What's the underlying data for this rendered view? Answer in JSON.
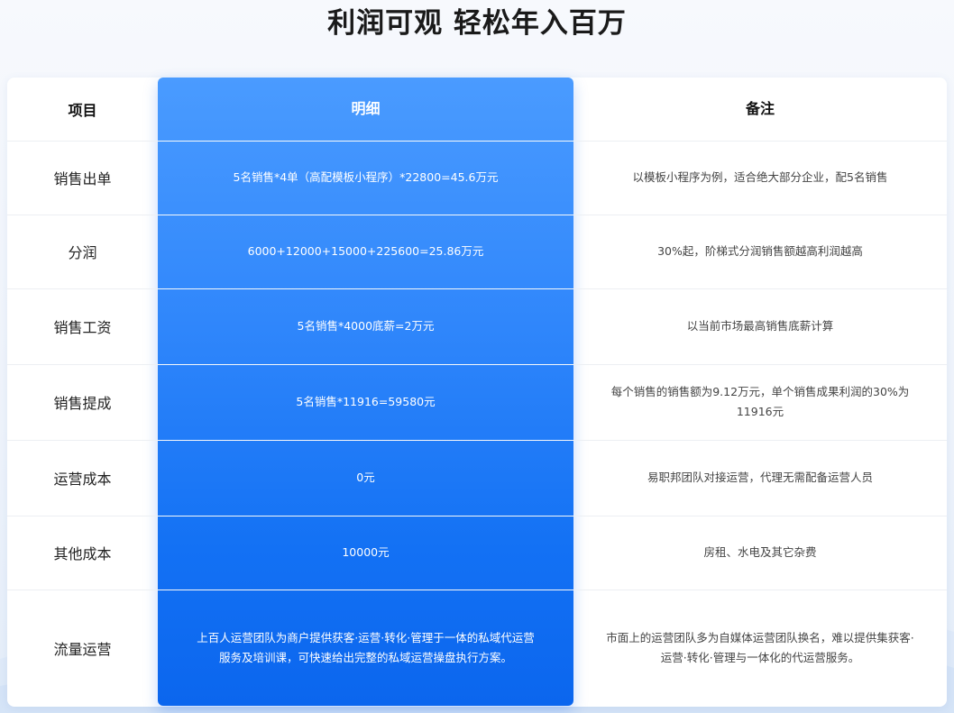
{
  "page": {
    "title": "利润可观 轻松年入百万"
  },
  "table": {
    "headers": {
      "item": "项目",
      "detail": "明细",
      "note": "备注"
    },
    "rows": [
      {
        "item": "销售出单",
        "detail": "5名销售*4单（高配模板小程序）*22800=45.6万元",
        "note": "以模板小程序为例，适合绝大部分企业，配5名销售"
      },
      {
        "item": "分润",
        "detail": "6000+12000+15000+225600=25.86万元",
        "note": "30%起，阶梯式分润销售额越高利润越高"
      },
      {
        "item": "销售工资",
        "detail": "5名销售*4000底薪=2万元",
        "note": "以当前市场最高销售底薪计算"
      },
      {
        "item": "销售提成",
        "detail": "5名销售*11916=59580元",
        "note": "每个销售的销售额为9.12万元，单个销售成果利润的30%为11916元"
      },
      {
        "item": "运营成本",
        "detail": "0元",
        "note": "易职邦团队对接运营，代理无需配备运营人员"
      },
      {
        "item": "其他成本",
        "detail": "10000元",
        "note": "房租、水电及其它杂费"
      },
      {
        "item": "流量运营",
        "detail": "上百人运营团队为商户提供获客·运营·转化·管理于一体的私域代运营服务及培训课，可快速给出完整的私域运营操盘执行方案。",
        "note": "市面上的运营团队多为自媒体运营团队换名，难以提供集获客·运营·转化·管理与一体化的代运营服务。"
      }
    ]
  },
  "colors": {
    "accent_top": "#4a9bff",
    "accent_bottom": "#0b66ee",
    "text_dark": "#222222",
    "text_note": "#444444"
  }
}
